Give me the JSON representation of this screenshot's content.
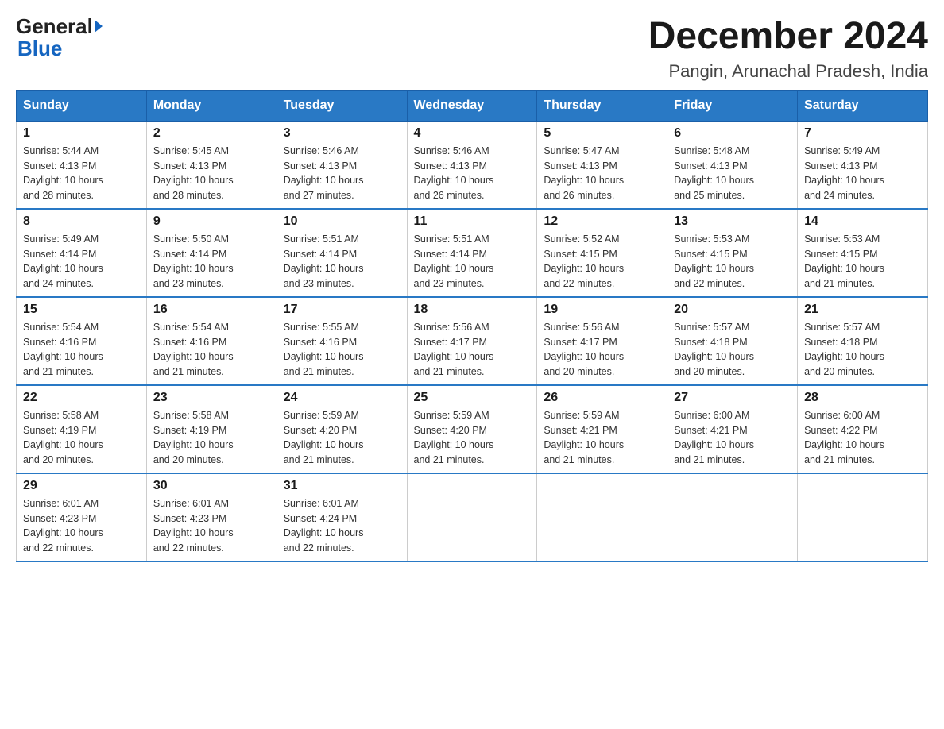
{
  "header": {
    "logo_general": "General",
    "logo_blue": "Blue",
    "month_title": "December 2024",
    "location": "Pangin, Arunachal Pradesh, India"
  },
  "weekdays": [
    "Sunday",
    "Monday",
    "Tuesday",
    "Wednesday",
    "Thursday",
    "Friday",
    "Saturday"
  ],
  "weeks": [
    [
      {
        "day": "1",
        "sunrise": "5:44 AM",
        "sunset": "4:13 PM",
        "daylight": "10 hours and 28 minutes."
      },
      {
        "day": "2",
        "sunrise": "5:45 AM",
        "sunset": "4:13 PM",
        "daylight": "10 hours and 28 minutes."
      },
      {
        "day": "3",
        "sunrise": "5:46 AM",
        "sunset": "4:13 PM",
        "daylight": "10 hours and 27 minutes."
      },
      {
        "day": "4",
        "sunrise": "5:46 AM",
        "sunset": "4:13 PM",
        "daylight": "10 hours and 26 minutes."
      },
      {
        "day": "5",
        "sunrise": "5:47 AM",
        "sunset": "4:13 PM",
        "daylight": "10 hours and 26 minutes."
      },
      {
        "day": "6",
        "sunrise": "5:48 AM",
        "sunset": "4:13 PM",
        "daylight": "10 hours and 25 minutes."
      },
      {
        "day": "7",
        "sunrise": "5:49 AM",
        "sunset": "4:13 PM",
        "daylight": "10 hours and 24 minutes."
      }
    ],
    [
      {
        "day": "8",
        "sunrise": "5:49 AM",
        "sunset": "4:14 PM",
        "daylight": "10 hours and 24 minutes."
      },
      {
        "day": "9",
        "sunrise": "5:50 AM",
        "sunset": "4:14 PM",
        "daylight": "10 hours and 23 minutes."
      },
      {
        "day": "10",
        "sunrise": "5:51 AM",
        "sunset": "4:14 PM",
        "daylight": "10 hours and 23 minutes."
      },
      {
        "day": "11",
        "sunrise": "5:51 AM",
        "sunset": "4:14 PM",
        "daylight": "10 hours and 23 minutes."
      },
      {
        "day": "12",
        "sunrise": "5:52 AM",
        "sunset": "4:15 PM",
        "daylight": "10 hours and 22 minutes."
      },
      {
        "day": "13",
        "sunrise": "5:53 AM",
        "sunset": "4:15 PM",
        "daylight": "10 hours and 22 minutes."
      },
      {
        "day": "14",
        "sunrise": "5:53 AM",
        "sunset": "4:15 PM",
        "daylight": "10 hours and 21 minutes."
      }
    ],
    [
      {
        "day": "15",
        "sunrise": "5:54 AM",
        "sunset": "4:16 PM",
        "daylight": "10 hours and 21 minutes."
      },
      {
        "day": "16",
        "sunrise": "5:54 AM",
        "sunset": "4:16 PM",
        "daylight": "10 hours and 21 minutes."
      },
      {
        "day": "17",
        "sunrise": "5:55 AM",
        "sunset": "4:16 PM",
        "daylight": "10 hours and 21 minutes."
      },
      {
        "day": "18",
        "sunrise": "5:56 AM",
        "sunset": "4:17 PM",
        "daylight": "10 hours and 21 minutes."
      },
      {
        "day": "19",
        "sunrise": "5:56 AM",
        "sunset": "4:17 PM",
        "daylight": "10 hours and 20 minutes."
      },
      {
        "day": "20",
        "sunrise": "5:57 AM",
        "sunset": "4:18 PM",
        "daylight": "10 hours and 20 minutes."
      },
      {
        "day": "21",
        "sunrise": "5:57 AM",
        "sunset": "4:18 PM",
        "daylight": "10 hours and 20 minutes."
      }
    ],
    [
      {
        "day": "22",
        "sunrise": "5:58 AM",
        "sunset": "4:19 PM",
        "daylight": "10 hours and 20 minutes."
      },
      {
        "day": "23",
        "sunrise": "5:58 AM",
        "sunset": "4:19 PM",
        "daylight": "10 hours and 20 minutes."
      },
      {
        "day": "24",
        "sunrise": "5:59 AM",
        "sunset": "4:20 PM",
        "daylight": "10 hours and 21 minutes."
      },
      {
        "day": "25",
        "sunrise": "5:59 AM",
        "sunset": "4:20 PM",
        "daylight": "10 hours and 21 minutes."
      },
      {
        "day": "26",
        "sunrise": "5:59 AM",
        "sunset": "4:21 PM",
        "daylight": "10 hours and 21 minutes."
      },
      {
        "day": "27",
        "sunrise": "6:00 AM",
        "sunset": "4:21 PM",
        "daylight": "10 hours and 21 minutes."
      },
      {
        "day": "28",
        "sunrise": "6:00 AM",
        "sunset": "4:22 PM",
        "daylight": "10 hours and 21 minutes."
      }
    ],
    [
      {
        "day": "29",
        "sunrise": "6:01 AM",
        "sunset": "4:23 PM",
        "daylight": "10 hours and 22 minutes."
      },
      {
        "day": "30",
        "sunrise": "6:01 AM",
        "sunset": "4:23 PM",
        "daylight": "10 hours and 22 minutes."
      },
      {
        "day": "31",
        "sunrise": "6:01 AM",
        "sunset": "4:24 PM",
        "daylight": "10 hours and 22 minutes."
      },
      null,
      null,
      null,
      null
    ]
  ],
  "labels": {
    "sunrise": "Sunrise:",
    "sunset": "Sunset:",
    "daylight": "Daylight:"
  }
}
